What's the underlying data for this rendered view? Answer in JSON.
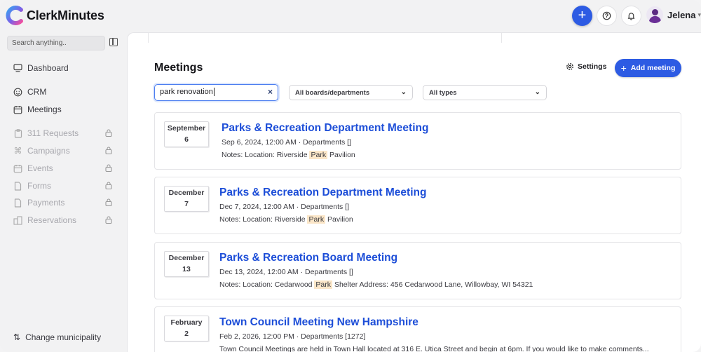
{
  "app": {
    "brand": "ClerkMinutes",
    "user_name": "Jelena",
    "add_icon": "+",
    "colors": {
      "accent": "#2d5be3",
      "link": "#1d4ed8",
      "highlight": "#fbe6c8"
    }
  },
  "sidebar": {
    "search_placeholder": "Search anything..",
    "items": [
      {
        "label": "Dashboard",
        "icon": "monitor-icon",
        "locked": false
      },
      {
        "label": "CRM",
        "icon": "smiley-icon",
        "locked": false
      },
      {
        "label": "Meetings",
        "icon": "calendar-icon",
        "locked": false
      },
      {
        "label": "311 Requests",
        "icon": "clipboard-icon",
        "locked": true
      },
      {
        "label": "Campaigns",
        "icon": "command-icon",
        "locked": true
      },
      {
        "label": "Events",
        "icon": "calendar-icon",
        "locked": true
      },
      {
        "label": "Forms",
        "icon": "document-icon",
        "locked": true
      },
      {
        "label": "Payments",
        "icon": "document-icon",
        "locked": true
      },
      {
        "label": "Reservations",
        "icon": "buildings-icon",
        "locked": true
      }
    ],
    "change_municipality": "Change municipality"
  },
  "main": {
    "title": "Meetings",
    "settings_label": "Settings",
    "add_meeting_label": "Add meeting",
    "search_value": "park renovation",
    "clear_icon": "×",
    "filter_boards": "All boards/departments",
    "filter_types": "All types",
    "meetings": [
      {
        "month": "September",
        "day": "6",
        "title": "Parks & Recreation Department Meeting",
        "meta": "Sep 6, 2024, 12:00 AM · Departments []",
        "notes_before": "Notes: Location: Riverside",
        "notes_hl": "Park",
        "notes_after": "Pavilion"
      },
      {
        "month": "December",
        "day": "7",
        "title": "Parks & Recreation Department Meeting",
        "meta": "Dec 7, 2024, 12:00 AM · Departments []",
        "notes_before": "Notes: Location: Riverside",
        "notes_hl": "Park",
        "notes_after": "Pavilion"
      },
      {
        "month": "December",
        "day": "13",
        "title": "Parks & Recreation Board Meeting",
        "meta": "Dec 13, 2024, 12:00 AM · Departments []",
        "notes_before": "Notes: Location: Cedarwood",
        "notes_hl": "Park",
        "notes_after": "Shelter Address: 456 Cedarwood Lane, Willowbay, WI 54321"
      },
      {
        "month": "February",
        "day": "2",
        "title": "Town Council Meeting New Hampshire",
        "meta": "Feb 2, 2026, 12:00 PM · Departments [1272]",
        "notes_before": "Town Council Meetings are held in Town Hall located at 316 E. Utica Street and begin at 6pm. If you would like to make comments...",
        "notes_hl": "",
        "notes_after": ""
      }
    ]
  }
}
